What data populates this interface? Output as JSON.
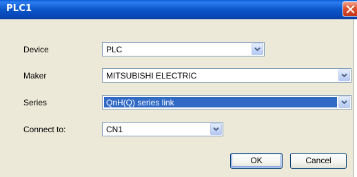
{
  "window": {
    "title": "PLC1",
    "close_icon": "close-x-icon"
  },
  "form": {
    "device": {
      "label": "Device",
      "value": "PLC"
    },
    "maker": {
      "label": "Maker",
      "value": "MITSUBISHI ELECTRIC"
    },
    "series": {
      "label": "Series",
      "value": "QnH(Q) series link"
    },
    "connect": {
      "label": "Connect to:",
      "value": "CN1"
    }
  },
  "buttons": {
    "ok_label": "OK",
    "cancel_label": "Cancel"
  },
  "colors": {
    "titlebar": "#0b56c8",
    "selection": "#316ac5",
    "dialog_bg": "#ece9d8"
  }
}
